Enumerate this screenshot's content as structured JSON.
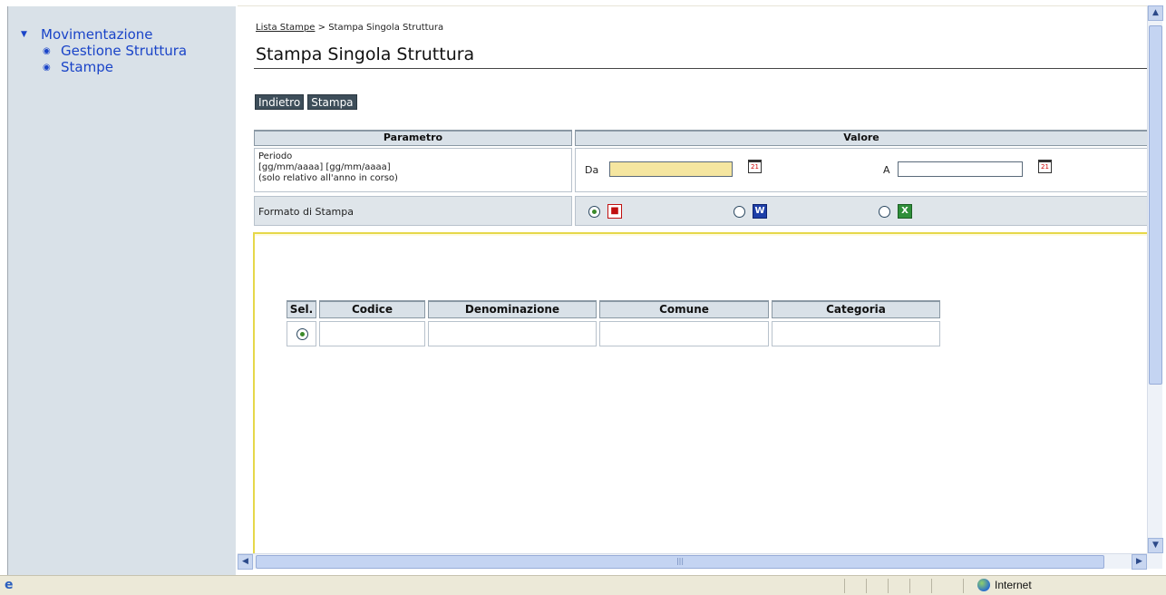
{
  "sidebar": {
    "root_label": "Movimentazione",
    "items": [
      {
        "label": "Gestione Struttura"
      },
      {
        "label": "Stampe"
      }
    ]
  },
  "breadcrumb": {
    "link": "Lista Stampe",
    "separator": " > ",
    "current": "Stampa Singola Struttura"
  },
  "page_title": "Stampa Singola Struttura",
  "toolbar": {
    "back_label": "Indietro",
    "print_label": "Stampa"
  },
  "params_table": {
    "headers": [
      "Parametro",
      "Valore"
    ],
    "period": {
      "label_line1": "Periodo",
      "label_line2": "[gg/mm/aaaa] [gg/mm/aaaa]",
      "label_line3": "(solo relativo all'anno in corso)",
      "from_label": "Da",
      "from_value": "",
      "to_label": "A",
      "to_value": ""
    },
    "format": {
      "label": "Formato di Stampa",
      "options": [
        {
          "name": "pdf",
          "icon": "pdf-icon",
          "selected": true
        },
        {
          "name": "word",
          "icon": "word-icon",
          "selected": false
        },
        {
          "name": "excel",
          "icon": "excel-icon",
          "selected": false
        }
      ]
    }
  },
  "results_table": {
    "headers": [
      "Sel.",
      "Codice",
      "Denominazione",
      "Comune",
      "Categoria"
    ],
    "rows": [
      {
        "selected": true,
        "codice": "",
        "denominazione": "",
        "comune": "",
        "categoria": ""
      }
    ]
  },
  "statusbar": {
    "zone": "Internet"
  },
  "colors": {
    "sidebar_bg": "#d9e1e8",
    "button_bg": "#3e4e5a",
    "required_field_bg": "#f5e6a0",
    "inner_frame_border": "#e6d84a",
    "link_blue": "#1a44c8"
  }
}
